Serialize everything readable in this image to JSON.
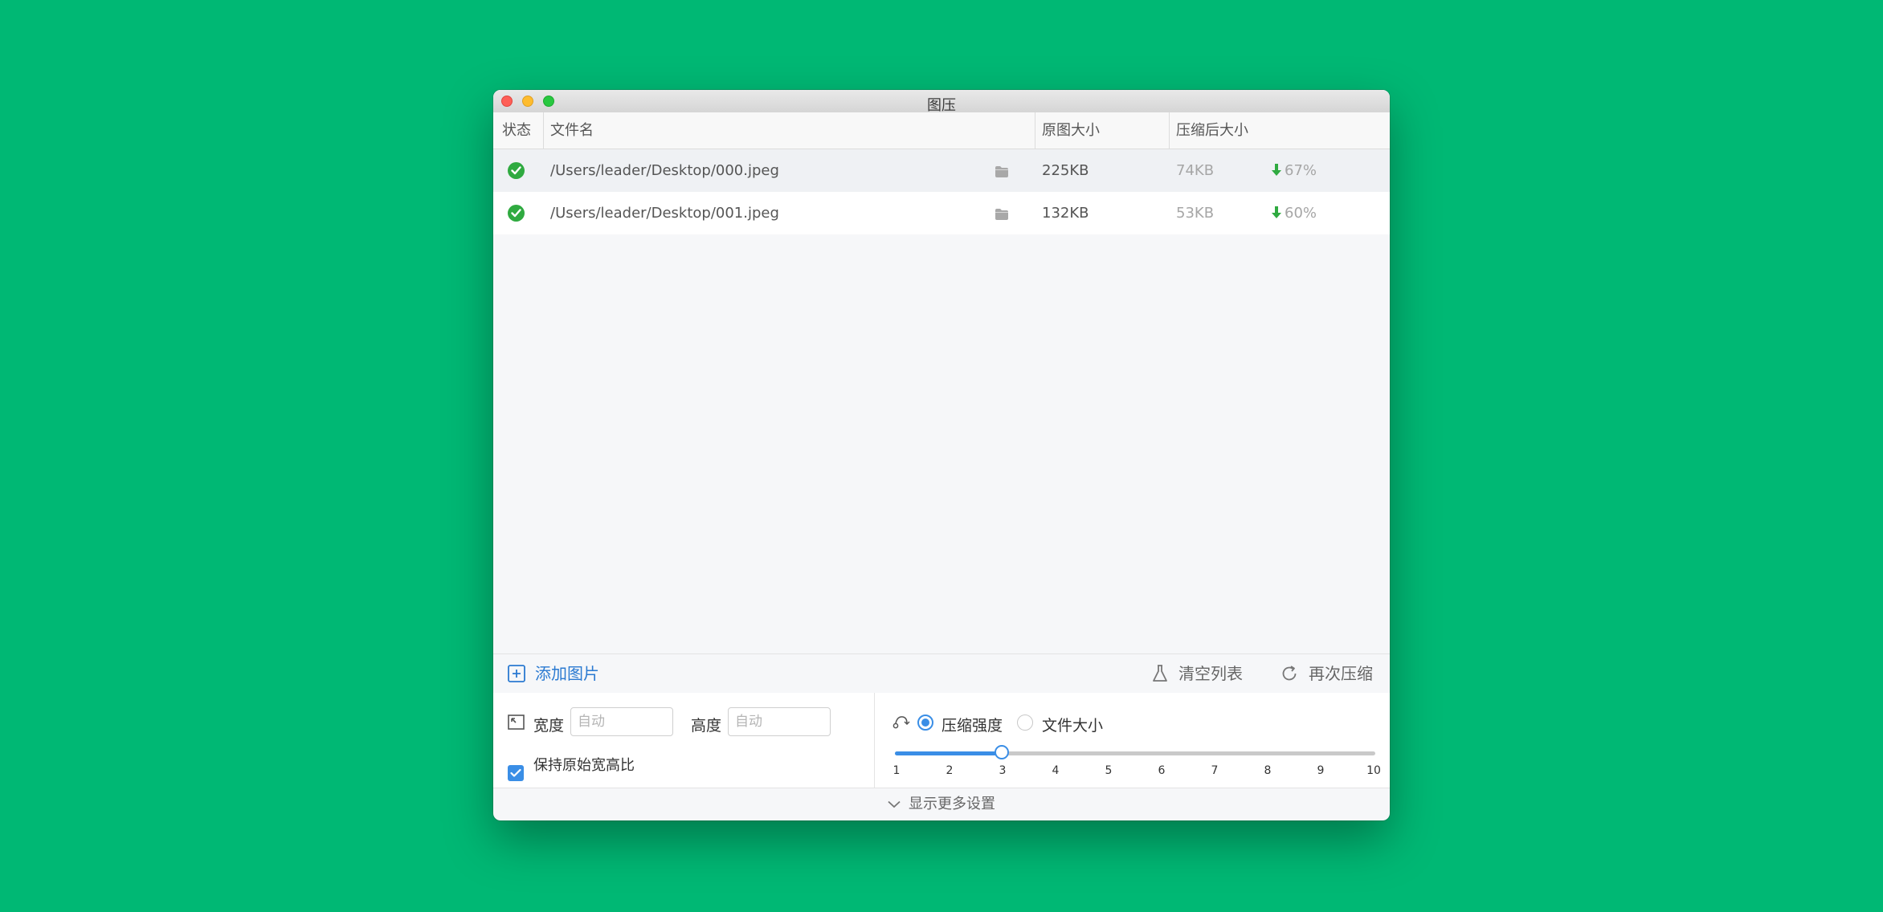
{
  "window": {
    "title": "图压"
  },
  "table": {
    "columns": {
      "status": "状态",
      "filename": "文件名",
      "original_size": "原图大小",
      "compressed_size": "压缩后大小"
    },
    "rows": [
      {
        "status": "done",
        "path": "/Users/leader/Desktop/000.jpeg",
        "original": "225KB",
        "compressed": "74KB",
        "reduction": "67%"
      },
      {
        "status": "done",
        "path": "/Users/leader/Desktop/001.jpeg",
        "original": "132KB",
        "compressed": "53KB",
        "reduction": "60%"
      }
    ]
  },
  "toolbar": {
    "add_label": "添加图片",
    "clear_label": "清空列表",
    "recompress_label": "再次压缩",
    "add_icon": "plus-square-icon",
    "clear_icon": "flask-icon",
    "recompress_icon": "refresh-icon"
  },
  "resize": {
    "width_label": "宽度",
    "width_placeholder": "自动",
    "width_value": "",
    "height_label": "高度",
    "height_placeholder": "自动",
    "height_value": "",
    "keep_ratio_label": "保持原始宽高比",
    "keep_ratio_checked": true
  },
  "compression": {
    "mode_options": [
      "压缩强度",
      "文件大小"
    ],
    "selected_mode": "压缩强度",
    "strength_ticks": [
      "1",
      "2",
      "3",
      "4",
      "5",
      "6",
      "7",
      "8",
      "9",
      "10"
    ],
    "strength_value": 3
  },
  "more_settings_label": "显示更多设置",
  "colors": {
    "background": "#00b874",
    "accent": "#3a8ee6",
    "success": "#2faa40",
    "link": "#2b7ad1"
  }
}
